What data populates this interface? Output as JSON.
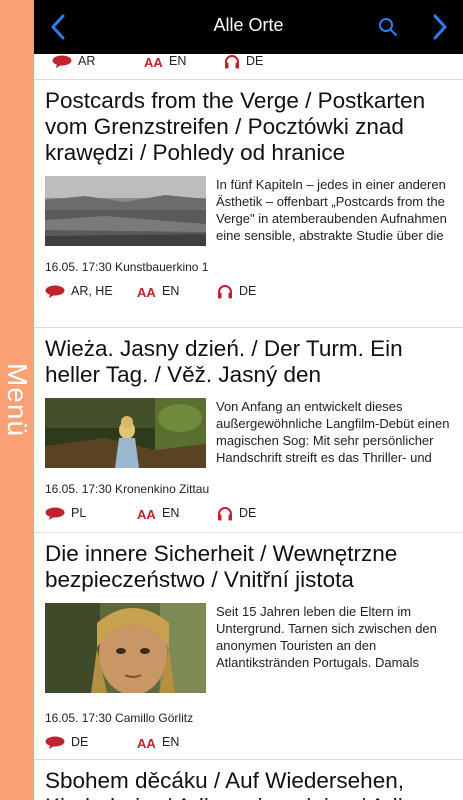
{
  "navbar": {
    "title": "Alle Orte"
  },
  "side_menu": {
    "label": "Menü"
  },
  "colors": {
    "accent": "#2f7cf6",
    "menu": "#f9a074",
    "lang_icon": "#c0232e"
  },
  "partial_entry": {
    "languages": {
      "original": "AR",
      "subtitles": "EN",
      "audio": "DE"
    }
  },
  "entries": [
    {
      "title": "Postcards from the Verge / Postkarten vom Grenzstreifen / Pocztówki znad krawędzi / Pohledy od hranice",
      "description": "In fünf Kapiteln – jedes in einer anderen Ästhetik – offenbart „Postcards from the Verge\" in atemberaubenden Aufnahmen eine sensible, abstrakte Studie über die",
      "meta": "16.05. 17:30 Kunstbauerkino 1",
      "languages": {
        "original": "AR, HE",
        "subtitles": "EN",
        "audio": "DE"
      }
    },
    {
      "title": "Wieża. Jasny dzień. / Der Turm. Ein heller Tag. / Věž. Jasný den",
      "description": "Von Anfang an entwickelt dieses außergewöhnliche Langfilm-Debüt einen magischen Sog: Mit sehr persönlicher Handschrift streift es das Thriller- und Mystery-Genre",
      "meta": "16.05. 17:30 Kronenkino Zittau",
      "languages": {
        "original": "PL",
        "subtitles": "EN",
        "audio": "DE"
      }
    },
    {
      "title": "Die innere Sicherheit / Wewnętrzne bezpieczeństwo / Vnitřní jistota",
      "description": "Seit 15 Jahren leben die Eltern im Untergrund. Tarnen sich zwischen den anonymen Touristen an den Atlantikstränden Portugals. Damals brachen sie ein Tabu: sie haben eine Tochter gezeugt. Ein einsames",
      "meta": "16.05. 17:30 Camillo Görlitz",
      "languages": {
        "original": "DE",
        "subtitles": "EN",
        "audio": ""
      }
    },
    {
      "title": "Sbohem děcáku / Auf Wiedersehen, Kinderheim / Adieu, sierociniec / Adieu"
    }
  ]
}
